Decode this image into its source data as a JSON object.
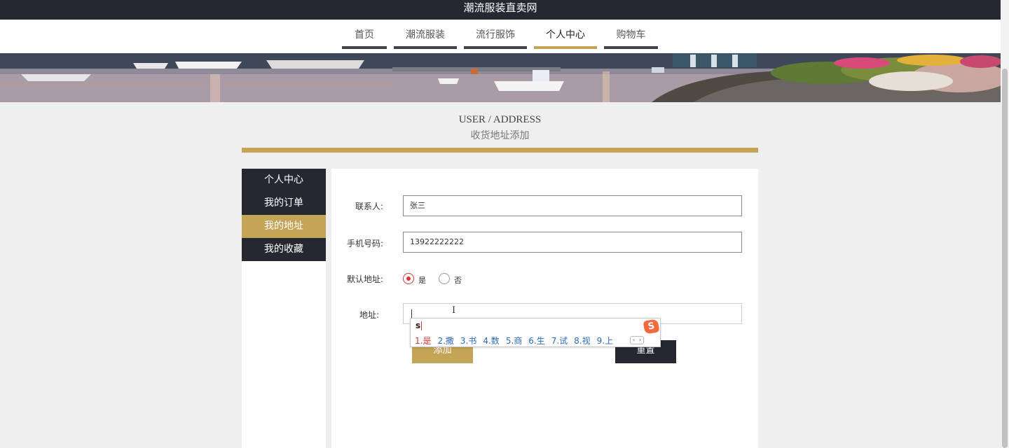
{
  "site": {
    "title": "潮流服装直卖网"
  },
  "nav": {
    "items": [
      {
        "label": "首页"
      },
      {
        "label": "潮流服装"
      },
      {
        "label": "流行服饰"
      },
      {
        "label": "个人中心",
        "active": true
      },
      {
        "label": "购物车"
      }
    ]
  },
  "heading": {
    "en": "USER / ADDRESS",
    "cn": "收货地址添加"
  },
  "sidebar": {
    "items": [
      {
        "label": "个人中心"
      },
      {
        "label": "我的订单"
      },
      {
        "label": "我的地址",
        "active": true
      },
      {
        "label": "我的收藏"
      }
    ]
  },
  "form": {
    "contact_label": "联系人:",
    "contact_value": "张三",
    "phone_label": "手机号码:",
    "phone_value": "13922222222",
    "default_label": "默认地址:",
    "default_yes": "是",
    "default_no": "否",
    "default_selected": "是",
    "address_label": "地址:",
    "address_value": "",
    "add_button": "添加",
    "reset_button": "重置"
  },
  "ime": {
    "input": "s",
    "logo": "S",
    "candidates": [
      "1.是",
      "2.撒",
      "3.书",
      "4.数",
      "5.商",
      "6.生",
      "7.试",
      "8.视",
      "9.上"
    ],
    "pager_prev": "‹",
    "pager_next": "›"
  },
  "colors": {
    "accent": "#c4a457",
    "dark": "#252830",
    "radio_checked": "#dd3333",
    "ime_candidate": "#2b6ab8"
  }
}
